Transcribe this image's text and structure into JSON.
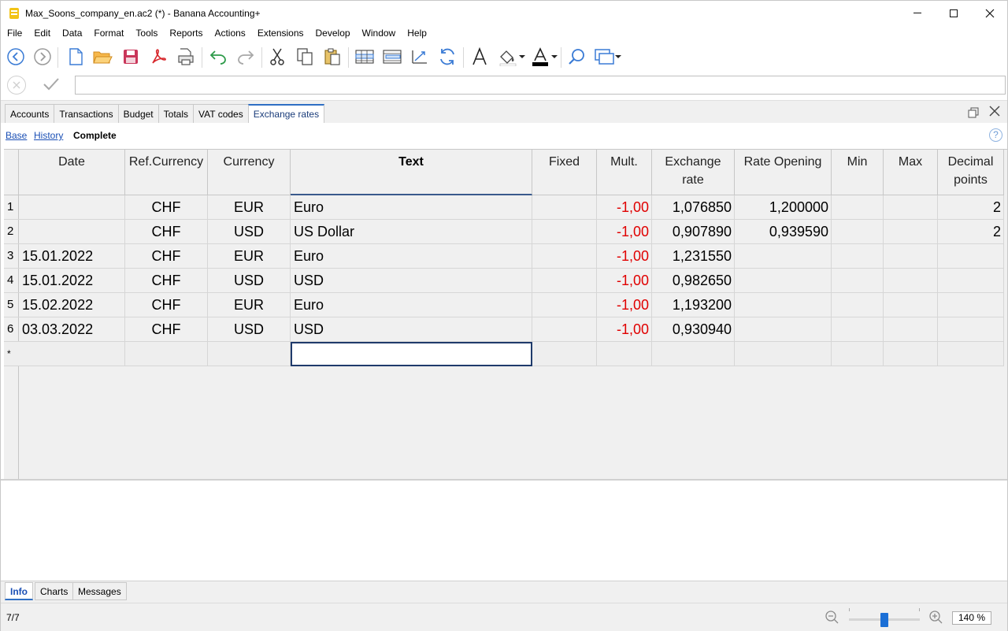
{
  "window": {
    "title": "Max_Soons_company_en.ac2 (*) - Banana Accounting+"
  },
  "menu": [
    "File",
    "Edit",
    "Data",
    "Format",
    "Tools",
    "Reports",
    "Actions",
    "Extensions",
    "Develop",
    "Window",
    "Help"
  ],
  "toolbar_icons": [
    "back-icon",
    "forward-icon",
    "new-file-icon",
    "open-folder-icon",
    "save-icon",
    "pdf-icon",
    "print-preview-icon",
    "undo-icon",
    "redo-icon",
    "cut-icon",
    "copy-icon",
    "paste-icon",
    "insert-rows-icon",
    "add-row-icon",
    "sort-icon",
    "recalculate-icon",
    "font-icon",
    "fill-color-icon",
    "text-color-icon",
    "find-icon",
    "window-icon"
  ],
  "edit_row": {
    "value": ""
  },
  "tabs": [
    {
      "label": "Accounts",
      "active": false
    },
    {
      "label": "Transactions",
      "active": false
    },
    {
      "label": "Budget",
      "active": false
    },
    {
      "label": "Totals",
      "active": false
    },
    {
      "label": "VAT codes",
      "active": false
    },
    {
      "label": "Exchange rates",
      "active": true
    }
  ],
  "views": [
    {
      "label": "Base",
      "active": false
    },
    {
      "label": "History",
      "active": false
    },
    {
      "label": "Complete",
      "active": true
    }
  ],
  "table": {
    "columns": [
      {
        "key": "date",
        "label": "Date"
      },
      {
        "key": "ref",
        "label": "Ref.Currency"
      },
      {
        "key": "cur",
        "label": "Currency"
      },
      {
        "key": "text",
        "label": "Text"
      },
      {
        "key": "fixed",
        "label": "Fixed"
      },
      {
        "key": "mult",
        "label": "Mult."
      },
      {
        "key": "rate",
        "label": "Exchange rate"
      },
      {
        "key": "open",
        "label": "Rate Opening"
      },
      {
        "key": "min",
        "label": "Min"
      },
      {
        "key": "max",
        "label": "Max"
      },
      {
        "key": "dec",
        "label": "Decimal points"
      }
    ],
    "rows": [
      {
        "num": "1",
        "date": "",
        "ref": "CHF",
        "cur": "EUR",
        "text": "Euro",
        "fixed": "",
        "mult": "-1,00",
        "rate": "1,076850",
        "open": "1,200000",
        "min": "",
        "max": "",
        "dec": "2"
      },
      {
        "num": "2",
        "date": "",
        "ref": "CHF",
        "cur": "USD",
        "text": "US Dollar",
        "fixed": "",
        "mult": "-1,00",
        "rate": "0,907890",
        "open": "0,939590",
        "min": "",
        "max": "",
        "dec": "2"
      },
      {
        "num": "3",
        "date": "15.01.2022",
        "ref": "CHF",
        "cur": "EUR",
        "text": "Euro",
        "fixed": "",
        "mult": "-1,00",
        "rate": "1,231550",
        "open": "",
        "min": "",
        "max": "",
        "dec": ""
      },
      {
        "num": "4",
        "date": "15.01.2022",
        "ref": "CHF",
        "cur": "USD",
        "text": "USD",
        "fixed": "",
        "mult": "-1,00",
        "rate": "0,982650",
        "open": "",
        "min": "",
        "max": "",
        "dec": ""
      },
      {
        "num": "5",
        "date": "15.02.2022",
        "ref": "CHF",
        "cur": "EUR",
        "text": "Euro",
        "fixed": "",
        "mult": "-1,00",
        "rate": "1,193200",
        "open": "",
        "min": "",
        "max": "",
        "dec": ""
      },
      {
        "num": "6",
        "date": "03.03.2022",
        "ref": "CHF",
        "cur": "USD",
        "text": "USD",
        "fixed": "",
        "mult": "-1,00",
        "rate": "0,930940",
        "open": "",
        "min": "",
        "max": "",
        "dec": ""
      }
    ],
    "new_row_marker": "*"
  },
  "bottom_tabs": [
    {
      "label": "Info",
      "active": true
    },
    {
      "label": "Charts",
      "active": false
    },
    {
      "label": "Messages",
      "active": false
    }
  ],
  "status": {
    "row_count": "7/7",
    "zoom": "140 %",
    "zoom_level": 0.5
  },
  "colors": {
    "negative": "#e00000",
    "accent": "#2f6fc4",
    "brand": "#f2c316"
  }
}
